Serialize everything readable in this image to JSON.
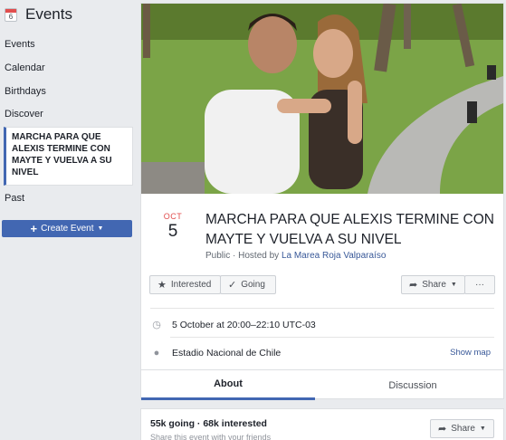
{
  "sidebar": {
    "title": "Events",
    "calendar_icon_day": "6",
    "items": [
      "Events",
      "Calendar",
      "Birthdays",
      "Discover"
    ],
    "active_event": "MARCHA PARA QUE ALEXIS TERMINE CON MAYTE Y VUELVA A SU NIVEL",
    "past_label": "Past",
    "create_button": "Create Event"
  },
  "event": {
    "month": "OCT",
    "day": "5",
    "title": "MARCHA PARA QUE ALEXIS TERMINE CON MAYTE Y VUELVA A SU NIVEL",
    "privacy": "Public",
    "hosted_by_prefix": " · Hosted by ",
    "host": "La Marea Roja Valparaíso",
    "datetime": "5 October at 20:00–22:10 UTC-03",
    "location": "Estadio Nacional de Chile",
    "show_map": "Show map"
  },
  "actions": {
    "interested": "Interested",
    "going": "Going",
    "share": "Share",
    "more": "···"
  },
  "tabs": {
    "about": "About",
    "discussion": "Discussion"
  },
  "stats": {
    "summary": "55k going · 68k interested",
    "share_prompt": "Share this event with your friends",
    "share": "Share"
  },
  "colors": {
    "accent": "#4267b2",
    "link": "#385898",
    "month": "#e14e4e"
  }
}
